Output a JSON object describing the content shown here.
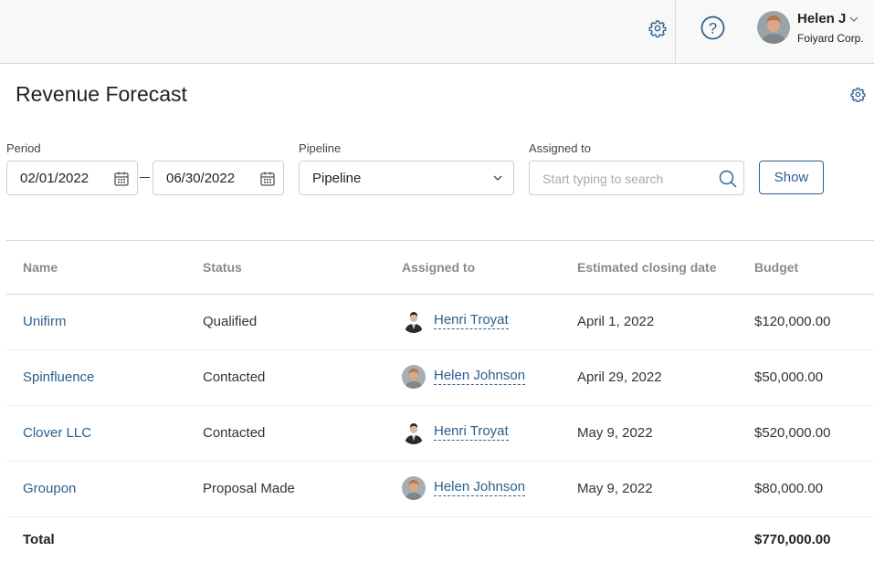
{
  "topbar": {
    "user_name": "Helen J",
    "company": "Foiyard Corp."
  },
  "page": {
    "title": "Revenue Forecast"
  },
  "filters": {
    "period_label": "Period",
    "date_from": "02/01/2022",
    "date_to": "06/30/2022",
    "pipeline_label": "Pipeline",
    "pipeline_value": "Pipeline",
    "assigned_label": "Assigned to",
    "assigned_placeholder": "Start typing to search",
    "show_button": "Show"
  },
  "table": {
    "headers": [
      "Name",
      "Status",
      "Assigned to",
      "Estimated closing date",
      "Budget"
    ],
    "rows": [
      {
        "name": "Unifirm",
        "status": "Qualified",
        "assigned": "Henri Troyat",
        "avatar": "male",
        "date": "April 1, 2022",
        "budget": "$120,000.00"
      },
      {
        "name": "Spinfluence",
        "status": "Contacted",
        "assigned": "Helen Johnson",
        "avatar": "female",
        "date": "April 29, 2022",
        "budget": "$50,000.00"
      },
      {
        "name": "Clover LLC",
        "status": "Contacted",
        "assigned": "Henri Troyat",
        "avatar": "male",
        "date": "May 9, 2022",
        "budget": "$520,000.00"
      },
      {
        "name": "Groupon",
        "status": "Proposal Made",
        "assigned": "Helen Johnson",
        "avatar": "female",
        "date": "May 9, 2022",
        "budget": "$80,000.00"
      }
    ],
    "total_label": "Total",
    "total_value": "$770,000.00"
  },
  "colors": {
    "accent": "#2a5f8f",
    "header_bg": "#f8f8f8"
  }
}
